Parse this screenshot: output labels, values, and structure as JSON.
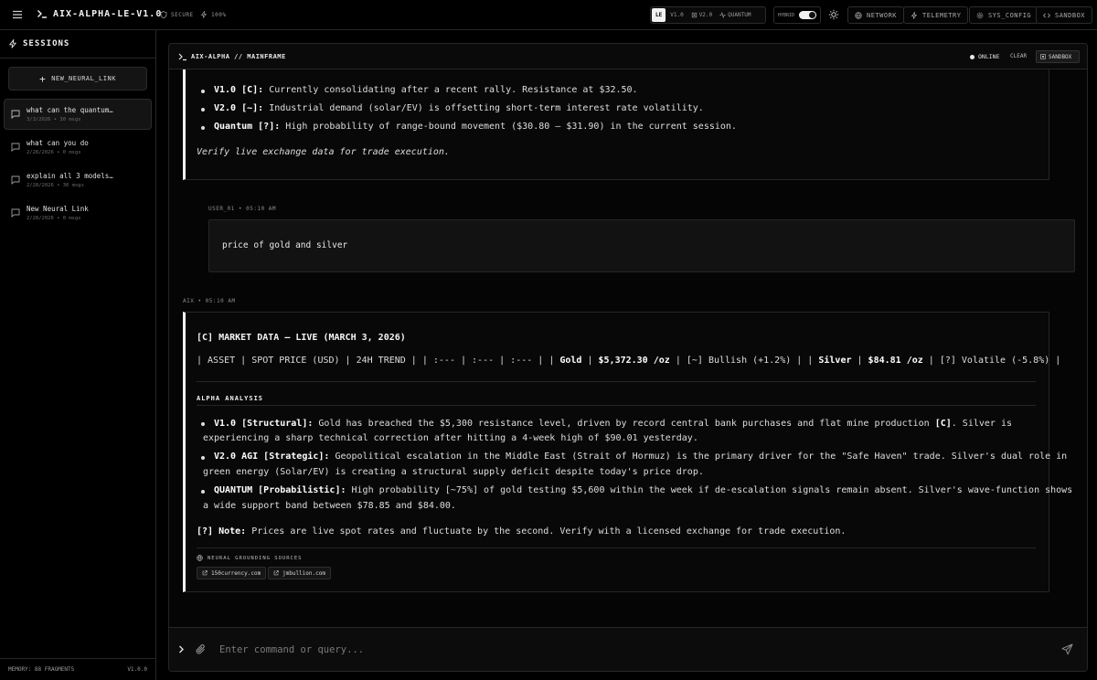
{
  "app": {
    "title": "AIX-ALPHA-LE-V1.0",
    "secure": "SECURE",
    "power": "100%"
  },
  "models": [
    {
      "label": "LE",
      "active": true
    },
    {
      "label": "V1.0"
    },
    {
      "label": "V2.0"
    },
    {
      "label": "QUANTUM"
    }
  ],
  "hybrid": {
    "label": "HYBRID",
    "on": true
  },
  "top_buttons": {
    "network": "NETWORK",
    "telemetry": "TELEMETRY",
    "sys_config": "SYS_CONFIG",
    "sandbox": "SANDBOX"
  },
  "sidebar": {
    "title": "SESSIONS",
    "new_button": "NEW_NEURAL_LINK",
    "sessions": [
      {
        "name": "what can the quantum…",
        "meta": "3/3/2026 • 30 msgs",
        "active": true
      },
      {
        "name": "what can you do",
        "meta": "2/28/2026 • 0 msgs"
      },
      {
        "name": "explain all 3 models…",
        "meta": "2/28/2026 • 30 msgs"
      },
      {
        "name": "New Neural Link",
        "meta": "2/28/2026 • 0 msgs"
      }
    ],
    "memory": "MEMORY: 88 FRAGMENTS",
    "version": "V1.0.0"
  },
  "main": {
    "title": "AIX-ALPHA // MAINFRAME",
    "status": "ONLINE",
    "clear": "CLEAR",
    "sandbox": "SANDBOX"
  },
  "chat": {
    "prev": {
      "b1_label": "V1.0 [C]:",
      "b1_text": " Currently consolidating after a recent rally. Resistance at $32.50.",
      "b2_label": "V2.0 [~]:",
      "b2_text": " Industrial demand (solar/EV) is offsetting short-term interest rate volatility.",
      "b3_label": "Quantum [?]:",
      "b3_text": " High probability of range-bound movement ($30.80 – $31.90) in the current session.",
      "footer": "Verify live exchange data for trade execution."
    },
    "user": {
      "label": "USER_01 • 05:10 AM",
      "text": "price of gold and silver"
    },
    "aix": {
      "label": "AIX • 05:10 AM",
      "heading": "[C] MARKET DATA – LIVE (MARCH 3, 2026)",
      "table_a": "| ASSET | SPOT PRICE (USD) | 24H TREND | | :--- | :--- | :--- | | ",
      "gold": "Gold",
      "t1": " | ",
      "gold_price": "$5,372.30 /oz",
      "t2": " | [~] Bullish (+1.2%) | | ",
      "silver": "Silver",
      "t3": " | ",
      "silver_price": "$84.81 /oz",
      "t4": " | [?] Volatile (-5.8%) |",
      "section": "ALPHA ANALYSIS",
      "b1_label": "V1.0 [Structural]:",
      "b1_line1": " Gold has breached the $5,300 resistance level, driven by record central bank purchases and flat mine production ",
      "b1_tag": "[C]",
      "b1_line1_end": ". Silver is",
      "b1_line2": "experiencing a sharp technical correction after hitting a 4-week high of $90.01 yesterday.",
      "b2_label": "V2.0 AGI [Strategic]:",
      "b2_line1": " Geopolitical escalation in the Middle East (Strait of Hormuz) is the primary driver for the \"Safe Haven\" trade. Silver's dual role in",
      "b2_line2": "green energy (Solar/EV) is creating a structural supply deficit despite today's price drop.",
      "b3_label": "QUANTUM [Probabilistic]:",
      "b3_line1": " High probability [~75%] of gold testing $5,600 within the week if de-escalation signals remain absent. Silver's wave-function shows",
      "b3_line2": "a wide support band between $78.85 and $84.00.",
      "note_label": "[?] Note:",
      "note_text": " Prices are live spot rates and fluctuate by the second. Verify with a licensed exchange for trade execution.",
      "sources_label": "NEURAL GROUNDING SOURCES",
      "sources": [
        "150currency.com",
        "jmbullion.com"
      ]
    }
  },
  "input": {
    "placeholder": "Enter command or query..."
  }
}
